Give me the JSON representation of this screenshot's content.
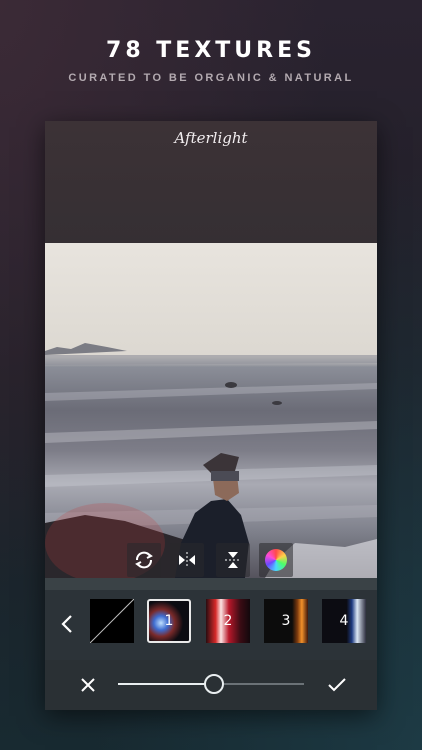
{
  "headline": "78 TEXTURES",
  "subheadline": "CURATED TO BE ORGANIC & NATURAL",
  "app": {
    "brand": "Afterlight"
  },
  "tools": [
    {
      "icon": "rotate-icon"
    },
    {
      "icon": "flip-horizontal-icon"
    },
    {
      "icon": "flip-vertical-icon"
    },
    {
      "icon": "color-wheel-icon"
    }
  ],
  "textures": [
    {
      "label": "",
      "selected": false
    },
    {
      "label": "1",
      "selected": true
    },
    {
      "label": "2",
      "selected": false
    },
    {
      "label": "3",
      "selected": false
    },
    {
      "label": "4",
      "selected": false
    }
  ],
  "slider": {
    "value_fraction": 0.51
  },
  "actions": {
    "cancel_icon": "close-icon",
    "confirm_icon": "checkmark-icon"
  },
  "colors": {
    "accent": "#e9eef0",
    "panel": "#2c3338"
  }
}
